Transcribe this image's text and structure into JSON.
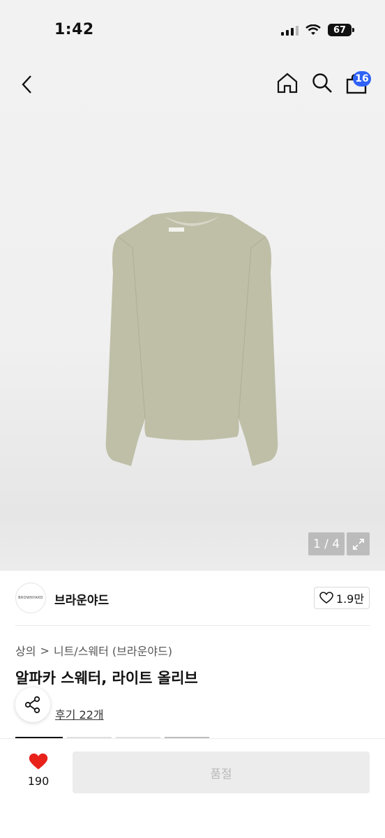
{
  "status_bar": {
    "time": "1:42",
    "battery": "67"
  },
  "header": {
    "cart_count": "16"
  },
  "gallery": {
    "pager": "1 / 4"
  },
  "brand": {
    "logo_text": "BROWNYARD",
    "name": "브라운야드",
    "likes": "1.9만"
  },
  "breadcrumb": {
    "category": "상의",
    "separator": ">",
    "subcategory": "니트/스웨터 (브라운야드)"
  },
  "product": {
    "title": "알파카 스웨터, 라이트 올리브",
    "review_link": "후기 22개"
  },
  "bottom": {
    "like_count": "190",
    "action_label": "품절"
  },
  "colors": {
    "badge": "#2f62f6",
    "heart": "#e8211b",
    "sweater": "#bfbfa8"
  }
}
